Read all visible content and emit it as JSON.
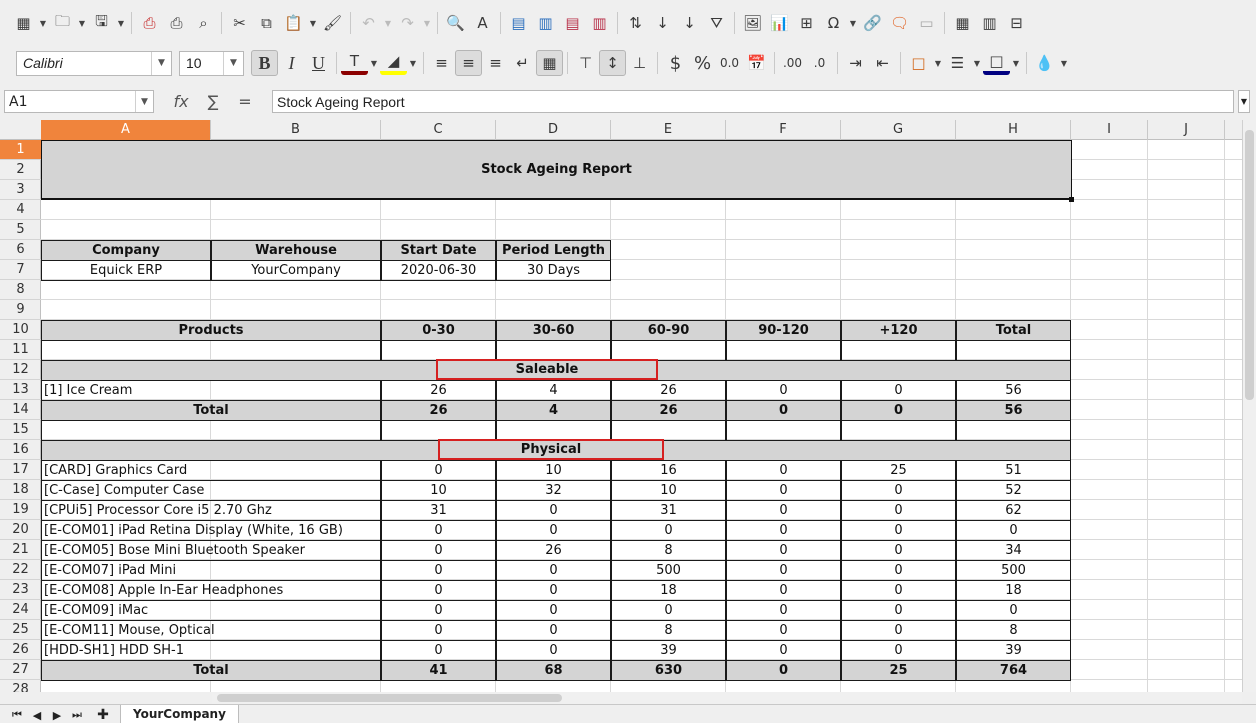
{
  "toolbar": {
    "font_name": "Calibri",
    "font_size": "10",
    "bold_label": "B",
    "italic_label": "I",
    "underline_label": "U",
    "currency_label": "$",
    "percent_label": "%",
    "number_label": "0.0",
    "special_char_label": "Ω"
  },
  "formula_bar": {
    "cell_ref": "A1",
    "fx_label": "fx",
    "sum_label": "∑",
    "equals_label": "=",
    "content": "Stock Ageing Report"
  },
  "columns": [
    "A",
    "B",
    "C",
    "D",
    "E",
    "F",
    "G",
    "H",
    "I",
    "J"
  ],
  "rows": [
    "1",
    "2",
    "3",
    "4",
    "5",
    "6",
    "7",
    "8",
    "9",
    "10",
    "11",
    "12",
    "13",
    "14",
    "15",
    "16",
    "17",
    "18",
    "19",
    "20",
    "21",
    "22",
    "23",
    "24",
    "25",
    "26",
    "27",
    "28"
  ],
  "report": {
    "title": "Stock Ageing Report",
    "info_headers": [
      "Company",
      "Warehouse",
      "Start Date",
      "Period Length"
    ],
    "info_values": [
      "Equick ERP",
      "YourCompany",
      "2020-06-30",
      "30 Days"
    ],
    "table_headers": [
      "Products",
      "0-30",
      "30-60",
      "60-90",
      "90-120",
      "+120",
      "Total"
    ],
    "saleable": {
      "label": "Saleable",
      "items": [
        [
          "[1] Ice Cream",
          "26",
          "4",
          "26",
          "0",
          "0",
          "56"
        ]
      ],
      "total": [
        "Total",
        "26",
        "4",
        "26",
        "0",
        "0",
        "56"
      ]
    },
    "physical": {
      "label": "Physical",
      "items": [
        [
          "[CARD] Graphics Card",
          "0",
          "10",
          "16",
          "0",
          "25",
          "51"
        ],
        [
          "[C-Case] Computer Case",
          "10",
          "32",
          "10",
          "0",
          "0",
          "52"
        ],
        [
          "[CPUi5] Processor Core i5 2.70 Ghz",
          "31",
          "0",
          "31",
          "0",
          "0",
          "62"
        ],
        [
          "[E-COM01] iPad Retina Display (White, 16 GB)",
          "0",
          "0",
          "0",
          "0",
          "0",
          "0"
        ],
        [
          "[E-COM05] Bose Mini Bluetooth Speaker",
          "0",
          "26",
          "8",
          "0",
          "0",
          "34"
        ],
        [
          "[E-COM07] iPad Mini",
          "0",
          "0",
          "500",
          "0",
          "0",
          "500"
        ],
        [
          "[E-COM08] Apple In-Ear Headphones",
          "0",
          "0",
          "18",
          "0",
          "0",
          "18"
        ],
        [
          "[E-COM09] iMac",
          "0",
          "0",
          "0",
          "0",
          "0",
          "0"
        ],
        [
          "[E-COM11] Mouse, Optical",
          "0",
          "0",
          "8",
          "0",
          "0",
          "8"
        ],
        [
          "[HDD-SH1] HDD SH-1",
          "0",
          "0",
          "39",
          "0",
          "0",
          "39"
        ]
      ],
      "total": [
        "Total",
        "41",
        "68",
        "630",
        "0",
        "25",
        "764"
      ]
    }
  },
  "sheet_tab": "YourCompany"
}
